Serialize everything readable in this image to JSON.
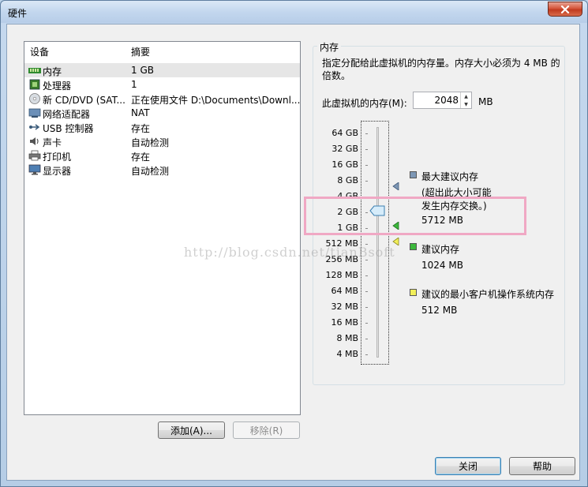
{
  "window": {
    "title": "硬件"
  },
  "device_list": {
    "columns": [
      "设备",
      "摘要"
    ],
    "rows": [
      {
        "name": "内存",
        "summary": "1 GB",
        "icon": "memory-icon"
      },
      {
        "name": "处理器",
        "summary": "1",
        "icon": "processor-icon"
      },
      {
        "name": "新 CD/DVD (SAT...",
        "summary": "正在使用文件 D:\\Documents\\Downl...",
        "icon": "cd-dvd-icon"
      },
      {
        "name": "网络适配器",
        "summary": "NAT",
        "icon": "network-adapter-icon"
      },
      {
        "name": "USB 控制器",
        "summary": "存在",
        "icon": "usb-icon"
      },
      {
        "name": "声卡",
        "summary": "自动检测",
        "icon": "sound-card-icon"
      },
      {
        "name": "打印机",
        "summary": "存在",
        "icon": "printer-icon"
      },
      {
        "name": "显示器",
        "summary": "自动检测",
        "icon": "display-icon"
      }
    ]
  },
  "buttons": {
    "add": "添加(A)...",
    "remove": "移除(R)",
    "close": "关闭",
    "help": "帮助"
  },
  "memory": {
    "group_title": "内存",
    "description": "指定分配给此虚拟机的内存量。内存大小必须为 4 MB 的倍数。",
    "field_label": "此虚拟机的内存(M):",
    "value": "2048",
    "unit": "MB",
    "scale_labels": [
      "64 GB",
      "32 GB",
      "16 GB",
      "8 GB",
      "4 GB",
      "2 GB",
      "1 GB",
      "512 MB",
      "256 MB",
      "128 MB",
      "64 MB",
      "32 MB",
      "16 MB",
      "8 MB",
      "4 MB"
    ],
    "legend": {
      "max_title": "最大建议内存",
      "max_note_1": "(超出此大小可能",
      "max_note_2": "发生内存交换。)",
      "max_value": "5712 MB",
      "rec_title": "建议内存",
      "rec_value": "1024 MB",
      "min_title": "建议的最小客户机操作系统内存",
      "min_value": "512 MB"
    }
  },
  "watermark": "http://blog.csdn.net/tianBsoft",
  "colors": {
    "max_marker": "#7d97b5",
    "rec_marker": "#3cb83c",
    "min_marker": "#f2ef5a",
    "highlight": "#f0a8c4"
  }
}
